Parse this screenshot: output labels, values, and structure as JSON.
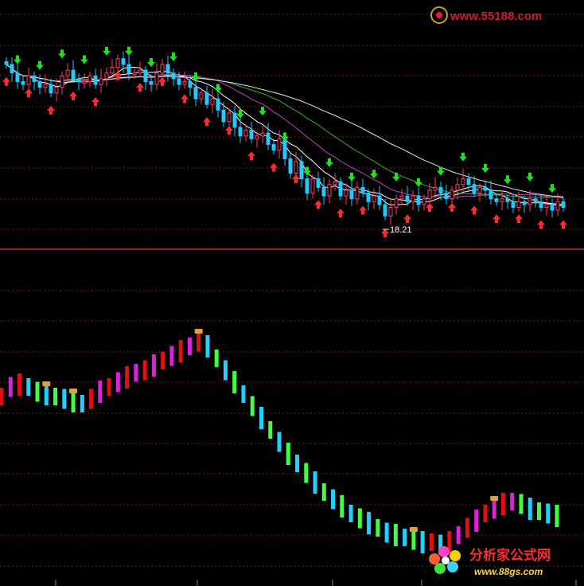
{
  "watermark_top": {
    "text": "www.55188.com",
    "color": "#e0203a"
  },
  "watermark_bottom": {
    "title": "分析家公式网",
    "url": "www.88gs.com",
    "title_color": "#ff2a2a",
    "url_color": "#ffd34a"
  },
  "colors": {
    "background": "#000000",
    "grid": "#8a1515",
    "panel_divider": "#c83030",
    "candle_up": "#ff3b6b",
    "candle_down": "#22c9ff",
    "ma_short": "#ffffff",
    "ma_medium": "#ffffff",
    "ma_long1": "#c040c0",
    "ma_long2": "#30b030",
    "ma_long3": "#e8e8e8",
    "arrow_buy": "#ff2a2a",
    "arrow_sell": "#20e020",
    "hist_up_red": "#e01010",
    "hist_up_magenta": "#e020e0",
    "hist_down_green": "#40ff40",
    "hist_down_cyan": "#20d0ff",
    "signal_marker": "#e0a040"
  },
  "chart_data": [
    {
      "type": "candlestick",
      "panel": "price",
      "title": "",
      "annotations": [
        {
          "text": "18.21",
          "kind": "low-marker"
        }
      ],
      "series": [
        {
          "name": "",
          "close": [
            23.6,
            23.3,
            23.0,
            22.9,
            23.2,
            23.0,
            22.8,
            22.9,
            22.6,
            22.8,
            23.2,
            23.4,
            23.1,
            23.0,
            23.0,
            23.2,
            22.9,
            23.1,
            23.3,
            23.5,
            23.8,
            23.6,
            23.3,
            23.3,
            23.4,
            23.0,
            22.9,
            23.3,
            23.6,
            23.3,
            23.1,
            22.9,
            23.0,
            22.8,
            22.4,
            22.6,
            22.2,
            22.4,
            22.0,
            21.6,
            21.9,
            21.4,
            21.1,
            21.3,
            21.0,
            21.1,
            21.2,
            20.8,
            20.6,
            21.0,
            20.3,
            19.8,
            20.2,
            19.6,
            19.1,
            19.6,
            19.3,
            19.0,
            19.4,
            19.5,
            19.0,
            19.2,
            18.9,
            19.3,
            19.1,
            18.8,
            19.0,
            18.7,
            18.3,
            18.6,
            18.9,
            19.0,
            18.8,
            19.0,
            18.7,
            18.9,
            19.2,
            19.3,
            19.1,
            18.9,
            19.2,
            19.4,
            19.6,
            19.4,
            19.1,
            19.3,
            19.2,
            18.9,
            18.8,
            18.9,
            18.8,
            18.6,
            18.8,
            18.7,
            18.9,
            18.8,
            18.6,
            18.7,
            18.5,
            18.8,
            18.6
          ]
        }
      ]
    },
    {
      "type": "bar",
      "panel": "indicator",
      "title": "",
      "series": [
        {
          "name": "",
          "values": [
            0.74,
            0.78,
            0.79,
            0.78,
            0.76,
            0.75,
            0.74,
            0.73,
            0.72,
            0.71,
            0.73,
            0.76,
            0.78,
            0.8,
            0.82,
            0.84,
            0.85,
            0.87,
            0.89,
            0.91,
            0.93,
            0.95,
            0.97,
            0.95,
            0.9,
            0.85,
            0.8,
            0.75,
            0.7,
            0.65,
            0.6,
            0.55,
            0.5,
            0.46,
            0.42,
            0.38,
            0.34,
            0.31,
            0.28,
            0.25,
            0.23,
            0.21,
            0.19,
            0.17,
            0.16,
            0.15,
            0.14,
            0.13,
            0.13,
            0.12,
            0.13,
            0.16,
            0.19,
            0.22,
            0.25,
            0.27,
            0.29,
            0.3,
            0.29,
            0.27,
            0.26,
            0.25,
            0.24
          ]
        }
      ]
    }
  ]
}
